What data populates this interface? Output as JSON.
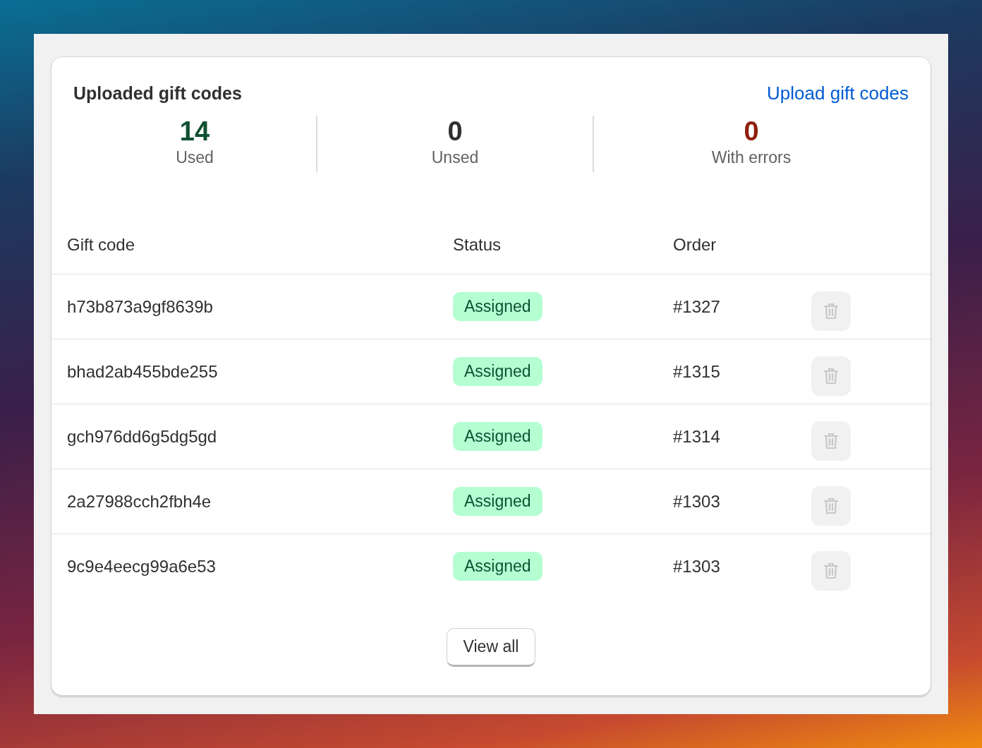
{
  "card": {
    "title": "Uploaded gift codes",
    "upload_link": "Upload gift codes"
  },
  "stats": [
    {
      "value": "14",
      "label": "Used",
      "color": "#0f5132"
    },
    {
      "value": "0",
      "label": "Unsed",
      "color": "#303030"
    },
    {
      "value": "0",
      "label": "With errors",
      "color": "#8e1f0b"
    }
  ],
  "table": {
    "columns": [
      "Gift code",
      "Status",
      "Order"
    ],
    "rows": [
      {
        "code": "h73b873a9gf8639b",
        "status": "Assigned",
        "order": "#1327",
        "delete_disabled": true
      },
      {
        "code": "bhad2ab455bde255",
        "status": "Assigned",
        "order": "#1315",
        "delete_disabled": true
      },
      {
        "code": "gch976dd6g5dg5gd",
        "status": "Assigned",
        "order": "#1314",
        "delete_disabled": true
      },
      {
        "code": "2a27988cch2fbh4e",
        "status": "Assigned",
        "order": "#1303",
        "delete_disabled": true
      },
      {
        "code": "9c9e4eecg99a6e53",
        "status": "Assigned",
        "order": "#1303",
        "delete_disabled": true
      }
    ]
  },
  "view_all": "View all"
}
